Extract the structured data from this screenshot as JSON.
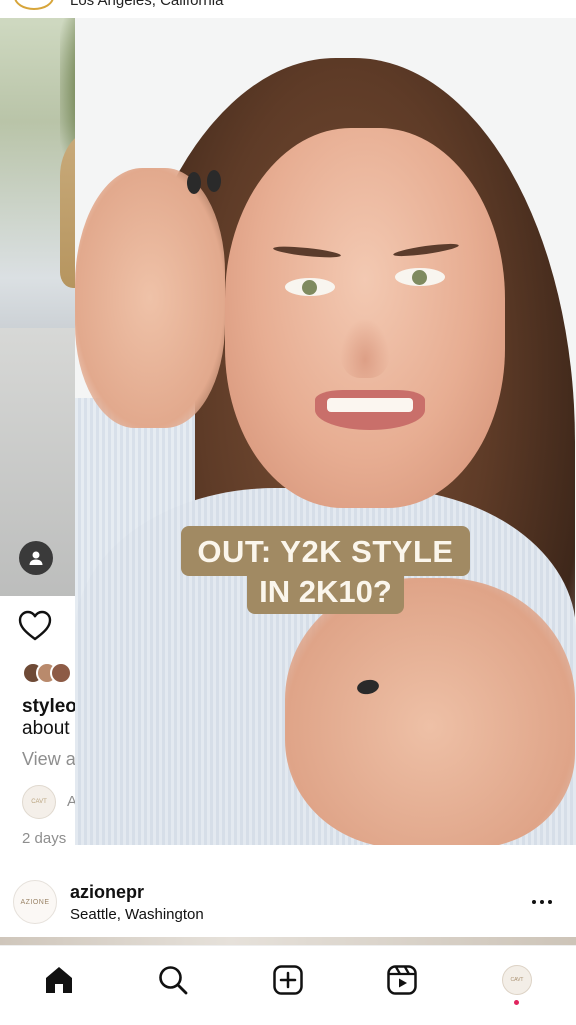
{
  "top": {
    "location": "Los Angeles, California"
  },
  "post": {
    "caption_user": "styleo",
    "caption_text": "about",
    "view_comments": "View a",
    "comment_initial": "A",
    "timestamp": "2 days"
  },
  "next_post": {
    "username": "azionepr",
    "location": "Seattle, Washington",
    "avatar_text": "AZIONE"
  },
  "overlay": {
    "headline_line1": "OUT: Y2K STYLE",
    "headline_line2": "IN 2K10?"
  },
  "tabbar": {
    "tabs": [
      "home-icon",
      "search-icon",
      "create-icon",
      "reels-icon",
      "profile-avatar"
    ],
    "notification_color": "#e0245e"
  },
  "colors": {
    "caption_bg": "#a18a63",
    "caption_text": "#fbf6ec"
  }
}
